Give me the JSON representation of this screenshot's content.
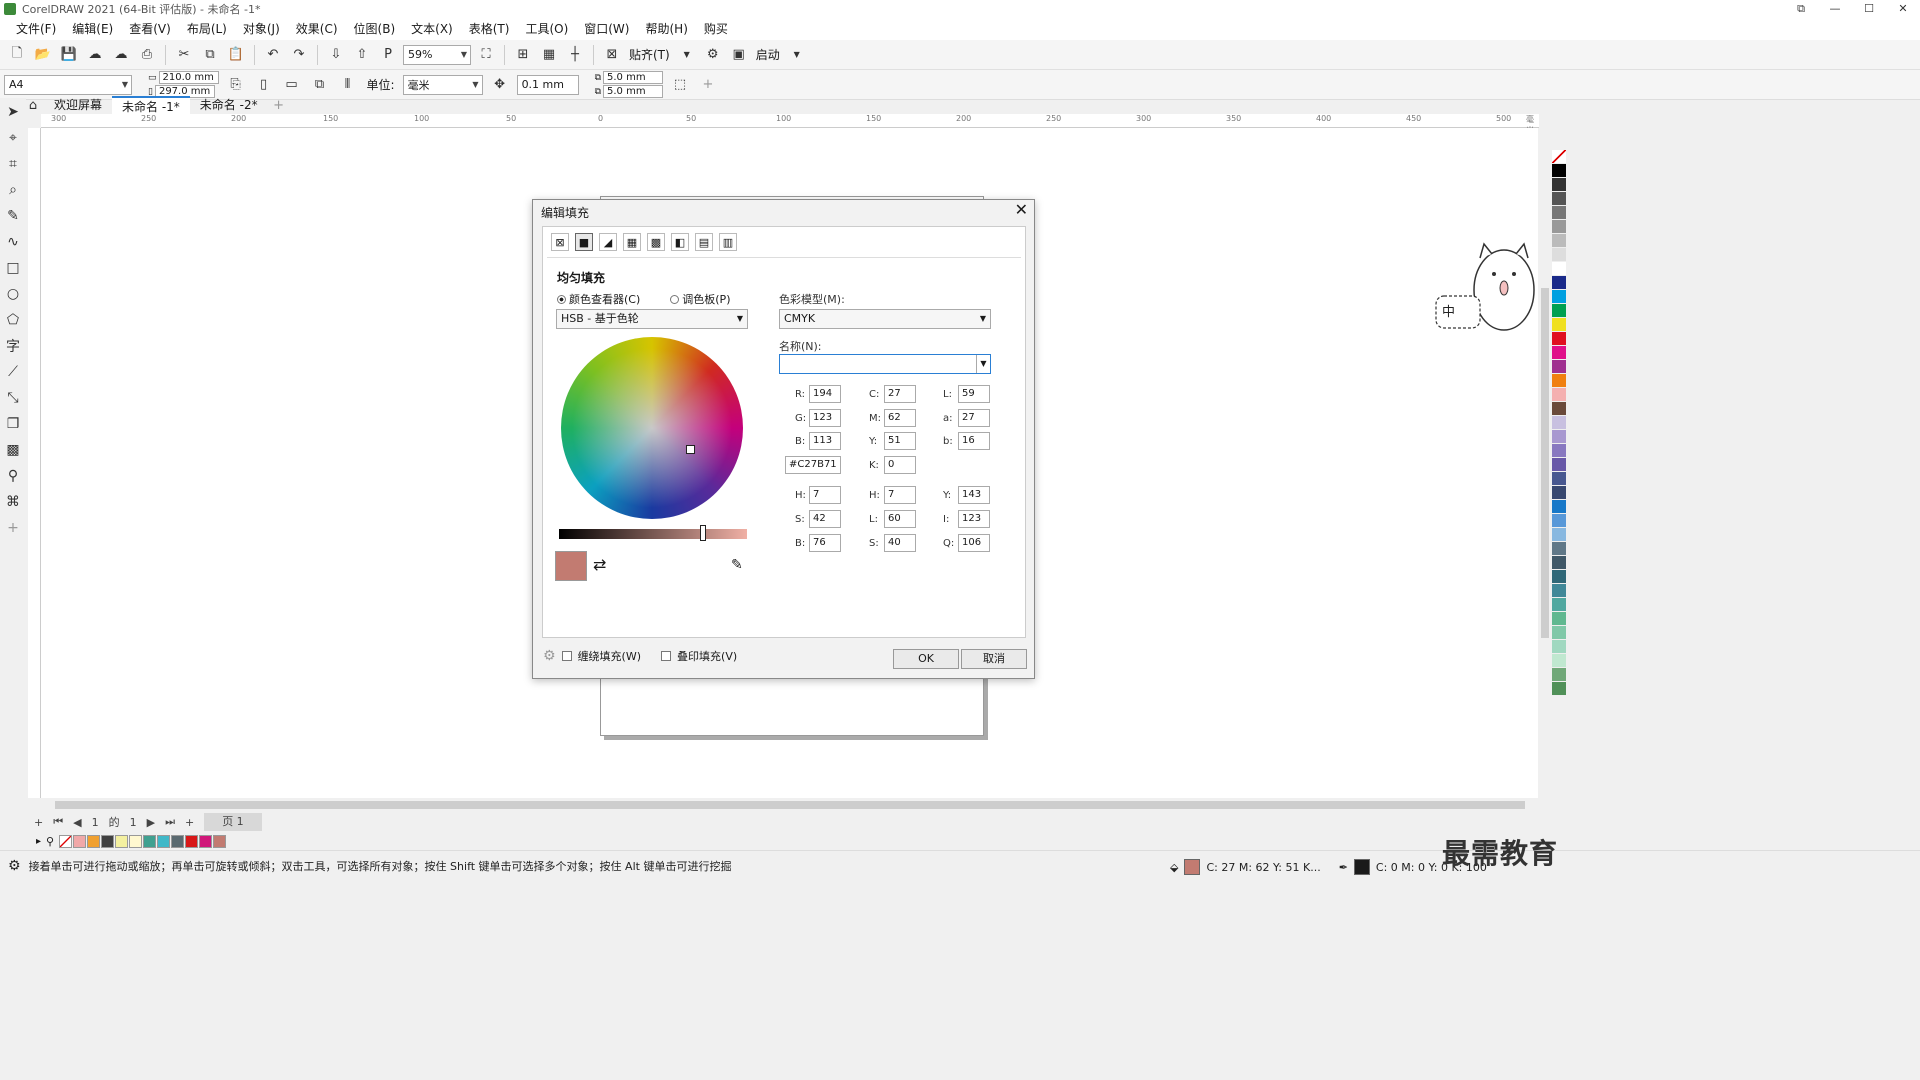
{
  "window": {
    "title": "CorelDRAW 2021 (64-Bit 评估版) - 未命名 -1*"
  },
  "menu": [
    "文件(F)",
    "编辑(E)",
    "查看(V)",
    "布局(L)",
    "对象(J)",
    "效果(C)",
    "位图(B)",
    "文本(X)",
    "表格(T)",
    "工具(O)",
    "窗口(W)",
    "帮助(H)",
    "购买"
  ],
  "toolbar": {
    "zoom": "59%",
    "snap_label": "贴齐(T)",
    "launch_label": "启动"
  },
  "property_bar": {
    "page_size": "A4",
    "width": "210.0 mm",
    "height": "297.0 mm",
    "unit_label": "单位:",
    "unit_value": "毫米",
    "nudge": "0.1 mm",
    "dup_x": "5.0 mm",
    "dup_y": "5.0 mm"
  },
  "tabs": [
    "欢迎屏幕",
    "未命名 -1*",
    "未命名 -2*"
  ],
  "ruler_ticks": [
    "300",
    "250",
    "200",
    "150",
    "100",
    "50",
    "0",
    "50",
    "100",
    "150",
    "200",
    "250",
    "300",
    "350",
    "400",
    "450",
    "500",
    "毫米"
  ],
  "page_nav": {
    "current": "1",
    "of_label": "的",
    "total": "1",
    "page_tab": "页 1"
  },
  "dialog": {
    "title": "编辑填充",
    "section_title": "均匀填充",
    "radio_viewer": "颜色查看器(C)",
    "radio_palette": "调色板(P)",
    "viewer_mode": "HSB - 基于色轮",
    "color_model_label": "色彩模型(M):",
    "color_model": "CMYK",
    "name_label": "名称(N):",
    "name_value": "",
    "rgb": {
      "R": "194",
      "G": "123",
      "B": "113"
    },
    "cmyk": {
      "C": "27",
      "M": "62",
      "Y": "51",
      "K": "0"
    },
    "lab": {
      "L": "59",
      "a": "27",
      "b": "16"
    },
    "hex": "#C27B71",
    "hsb": {
      "H": "7",
      "S": "42",
      "B": "76"
    },
    "hls": {
      "H": "7",
      "L": "60",
      "S": "40"
    },
    "yiq": {
      "Y": "143",
      "I": "123",
      "Q": "106"
    },
    "wrap_fill": "缠绕填充(W)",
    "overprint_fill": "叠印填充(V)",
    "ok": "OK",
    "cancel": "取消"
  },
  "status": {
    "hint": "接着单击可进行拖动或缩放；再单击可旋转或倾斜；双击工具，可选择所有对象；按住 Shift 键单击可选择多个对象；按住 Alt 键单击可进行挖掘",
    "fill_info": "C: 27 M: 62 Y: 51 K...",
    "outline_info": "C: 0 M: 0 Y: 0 K: 100"
  },
  "mascot_text": "中",
  "watermark": "最需教育",
  "colors": {
    "fill": "#C27B71",
    "accent": "#2a7fd4"
  }
}
